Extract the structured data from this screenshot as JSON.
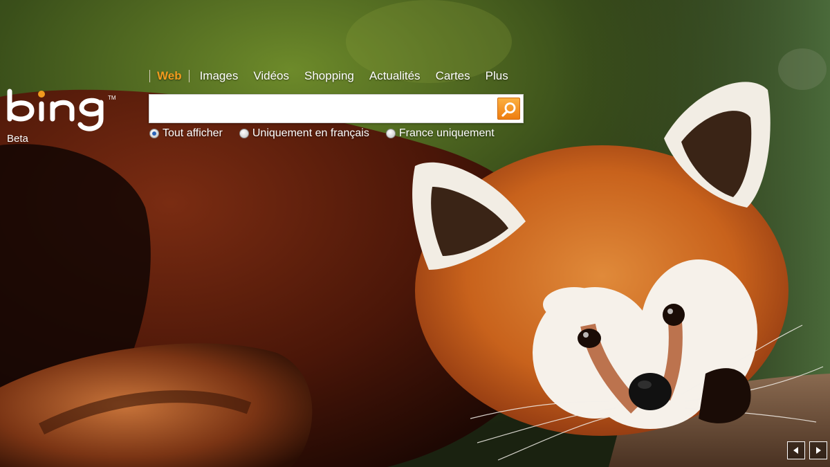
{
  "brand": {
    "logo_text": "bing",
    "tag": "Beta"
  },
  "nav": {
    "items": [
      {
        "label": "Web",
        "active": true
      },
      {
        "label": "Images",
        "active": false
      },
      {
        "label": "Vidéos",
        "active": false
      },
      {
        "label": "Shopping",
        "active": false
      },
      {
        "label": "Actualités",
        "active": false
      },
      {
        "label": "Cartes",
        "active": false
      },
      {
        "label": "Plus",
        "active": false
      }
    ]
  },
  "search": {
    "value": "",
    "placeholder": "",
    "button_icon": "search-icon"
  },
  "scope": {
    "options": [
      {
        "label": "Tout afficher",
        "checked": true
      },
      {
        "label": "Uniquement en français",
        "checked": false
      },
      {
        "label": "France uniquement",
        "checked": false
      }
    ]
  },
  "background": {
    "subject": "red-panda",
    "icons": [
      "previous-image-icon",
      "next-image-icon"
    ]
  },
  "colors": {
    "accent": "#f29b1e",
    "search_button": "#ee7d10",
    "text": "#ffffff"
  }
}
